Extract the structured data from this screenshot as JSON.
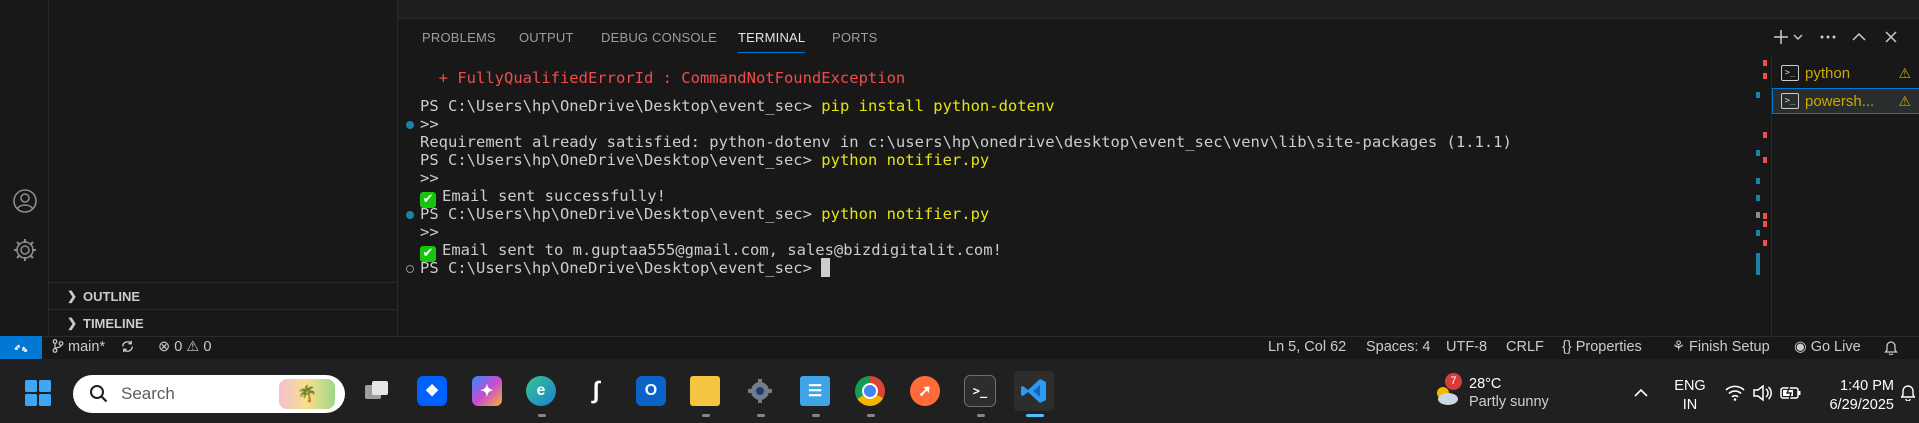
{
  "panel": {
    "tabs": [
      {
        "label": "PROBLEMS",
        "active": false
      },
      {
        "label": "OUTPUT",
        "active": false
      },
      {
        "label": "DEBUG CONSOLE",
        "active": false
      },
      {
        "label": "TERMINAL",
        "active": true
      },
      {
        "label": "PORTS",
        "active": false
      }
    ]
  },
  "sidebar": {
    "outline": "OUTLINE",
    "timeline": "TIMELINE"
  },
  "terminal": {
    "lines": {
      "l0": "  + FullyQualifiedErrorId : CommandNotFoundException",
      "l2_prompt": "PS C:\\Users\\hp\\OneDrive\\Desktop\\event_sec> ",
      "l2_cmd": "pip install python-dotenv",
      "l3": ">>",
      "l4": "Requirement already satisfied: python-dotenv in c:\\users\\hp\\onedrive\\desktop\\event_sec\\venv\\lib\\site-packages (1.1.1)",
      "l5_prompt": "PS C:\\Users\\hp\\OneDrive\\Desktop\\event_sec> ",
      "l5_cmd": "python notifier.py",
      "l6": ">>",
      "l7": "Email sent successfully!",
      "l8_prompt": "PS C:\\Users\\hp\\OneDrive\\Desktop\\event_sec> ",
      "l8_cmd": "python notifier.py",
      "l9": ">>",
      "l10": "Email sent to m.guptaa555@gmail.com, sales@bizdigitalit.com!",
      "l11_prompt": "PS C:\\Users\\hp\\OneDrive\\Desktop\\event_sec> "
    },
    "colors": {
      "error": "#f14c4c",
      "command": "#e5e510",
      "success": "#16c60c"
    }
  },
  "terminal_list": [
    {
      "name": "python",
      "warning": true,
      "selected": false
    },
    {
      "name": "powersh...",
      "warning": true,
      "selected": true
    }
  ],
  "statusbar": {
    "branch": "main*",
    "errors": "0",
    "warnings": "0",
    "position": "Ln 5, Col 62",
    "spaces": "Spaces: 4",
    "encoding": "UTF-8",
    "eol": "CRLF",
    "properties": "Properties",
    "finish_setup": "Finish Setup",
    "go_live": "Go Live"
  },
  "taskbar": {
    "search_placeholder": "Search",
    "weather_temp": "28°C",
    "weather_desc": "Partly sunny",
    "weather_badge": "7",
    "lang1": "ENG",
    "lang2": "IN",
    "time": "1:40 PM",
    "date": "6/29/2025",
    "apps": [
      "task-view",
      "dropbox",
      "copilot",
      "edge",
      "terminal-s",
      "outlook",
      "file-explorer",
      "settings",
      "notepad",
      "chrome",
      "postman",
      "terminal",
      "vscode"
    ]
  },
  "accent": "#0078d4"
}
